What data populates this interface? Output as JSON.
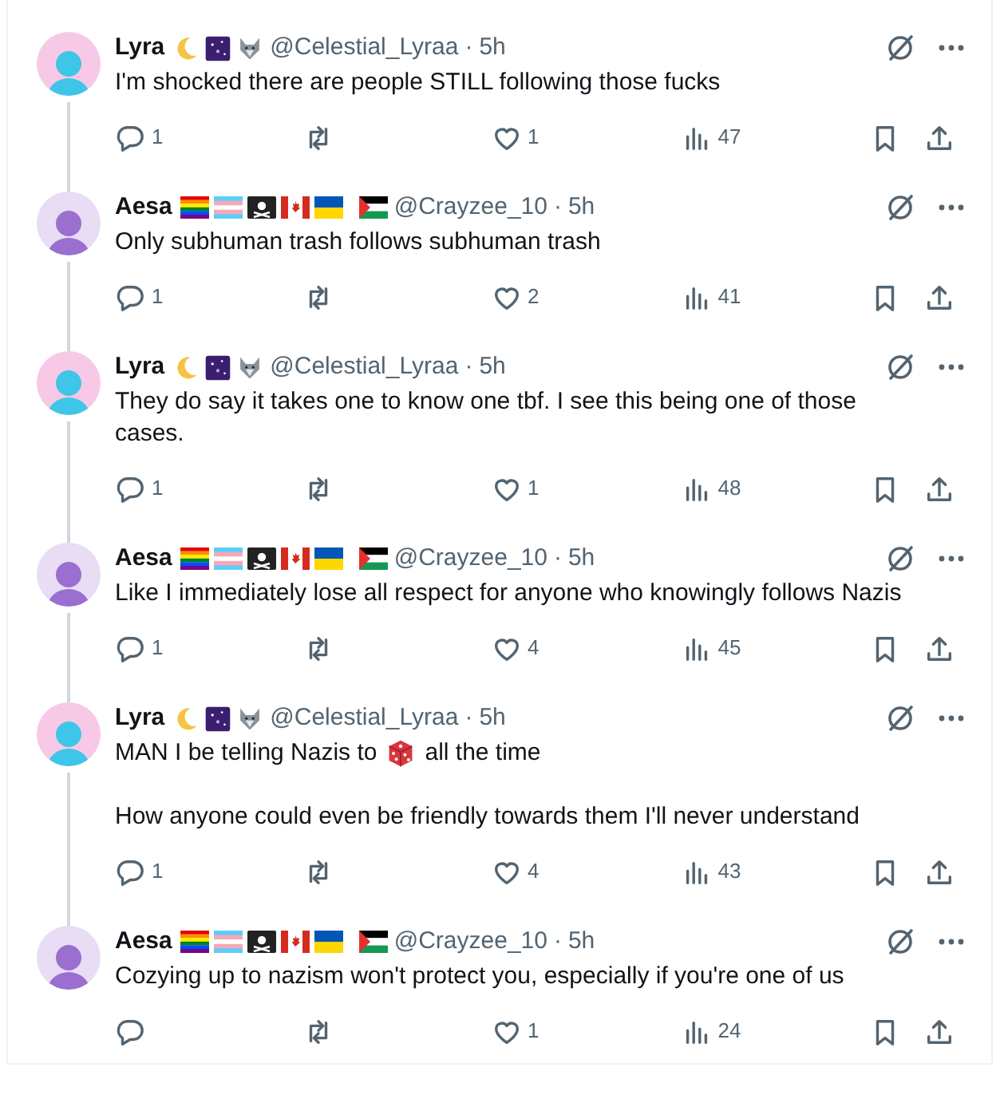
{
  "tweets": [
    {
      "kind": "celestial",
      "name": "Lyra",
      "handle": "@Celestial_Lyraa",
      "separator": "·",
      "time": "5h",
      "thread_line": true,
      "body": [
        [
          {
            "kind": "text",
            "text": "I'm shocked there are people STILL following those fucks"
          }
        ]
      ],
      "replies": "1",
      "likes": "1",
      "views": "47"
    },
    {
      "kind": "flags",
      "name": "Aesa",
      "handle": "@Crayzee_10",
      "separator": "·",
      "time": "5h",
      "thread_line": true,
      "body": [
        [
          {
            "kind": "text",
            "text": "Only subhuman trash follows subhuman trash"
          }
        ]
      ],
      "replies": "1",
      "likes": "2",
      "views": "41"
    },
    {
      "kind": "celestial",
      "name": "Lyra",
      "handle": "@Celestial_Lyraa",
      "separator": "·",
      "time": "5h",
      "thread_line": true,
      "body": [
        [
          {
            "kind": "text",
            "text": "They do say it takes one to know one tbf. I see this being one of those cases."
          }
        ]
      ],
      "replies": "1",
      "likes": "1",
      "views": "48"
    },
    {
      "kind": "flags",
      "name": "Aesa",
      "handle": "@Crayzee_10",
      "separator": "·",
      "time": "5h",
      "thread_line": true,
      "body": [
        [
          {
            "kind": "text",
            "text": "Like I immediately lose all respect for anyone who knowingly follows Nazis"
          }
        ]
      ],
      "replies": "1",
      "likes": "4",
      "views": "45"
    },
    {
      "kind": "celestial",
      "name": "Lyra",
      "handle": "@Celestial_Lyraa",
      "separator": "·",
      "time": "5h",
      "thread_line": true,
      "body": [
        [
          {
            "kind": "text",
            "text": "MAN I be telling Nazis to"
          },
          {
            "kind": "die"
          },
          {
            "kind": "text",
            "text": "all the time"
          }
        ],
        [
          {
            "kind": "text",
            "text": "How anyone could even be friendly towards them I'll never understand"
          }
        ]
      ],
      "replies": "1",
      "likes": "4",
      "views": "43"
    },
    {
      "kind": "flags",
      "name": "Aesa",
      "handle": "@Crayzee_10",
      "separator": "·",
      "time": "5h",
      "thread_line": false,
      "body": [
        [
          {
            "kind": "text",
            "text": "Cozying up to nazism won't protect you, especially if you're one of us"
          }
        ]
      ],
      "likes": "1",
      "views": "24"
    }
  ]
}
